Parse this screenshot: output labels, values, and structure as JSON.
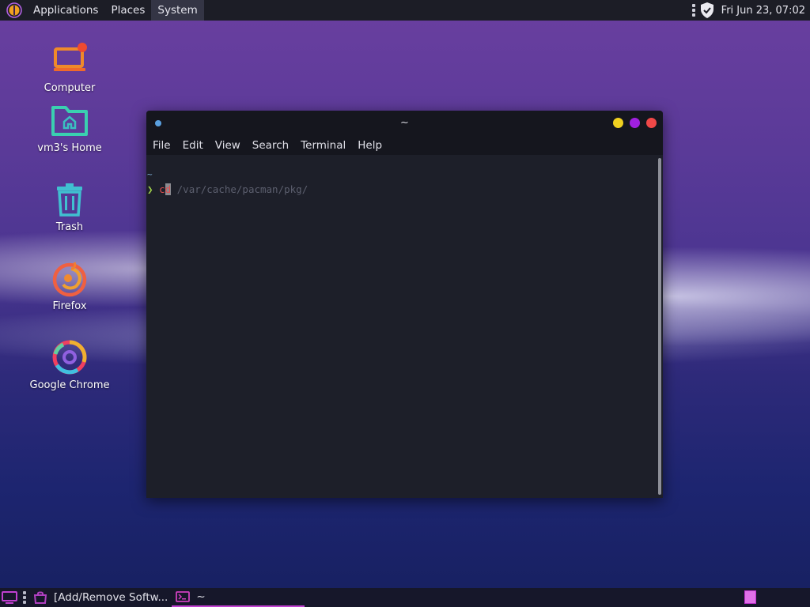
{
  "top_panel": {
    "menu": [
      "Applications",
      "Places",
      "System"
    ],
    "clock": "Fri Jun 23, 07:02"
  },
  "desktop": {
    "icons": [
      {
        "label": "Computer",
        "icon": "computer-icon"
      },
      {
        "label": "vm3's Home",
        "icon": "home-folder-icon"
      },
      {
        "label": "Trash",
        "icon": "trash-icon"
      },
      {
        "label": "Firefox",
        "icon": "firefox-icon"
      },
      {
        "label": "Google Chrome",
        "icon": "chrome-icon"
      }
    ]
  },
  "terminal": {
    "title": "~",
    "menu": [
      "File",
      "Edit",
      "View",
      "Search",
      "Terminal",
      "Help"
    ],
    "cwd_line": "~",
    "prompt_symbol": "❯",
    "typed_text": "c",
    "cursor_char": "d",
    "suggestion": " /var/cache/pacman/pkg/",
    "colors": {
      "close": "#f04848",
      "maximize": "#a020e0",
      "minimize": "#f0d020"
    }
  },
  "bottom_panel": {
    "tasks": [
      {
        "label": "[Add/Remove Softw...",
        "icon": "package-icon",
        "active": false
      },
      {
        "label": "~",
        "icon": "terminal-icon",
        "active": true
      }
    ]
  },
  "colors": {
    "accent": "#c040d0"
  }
}
